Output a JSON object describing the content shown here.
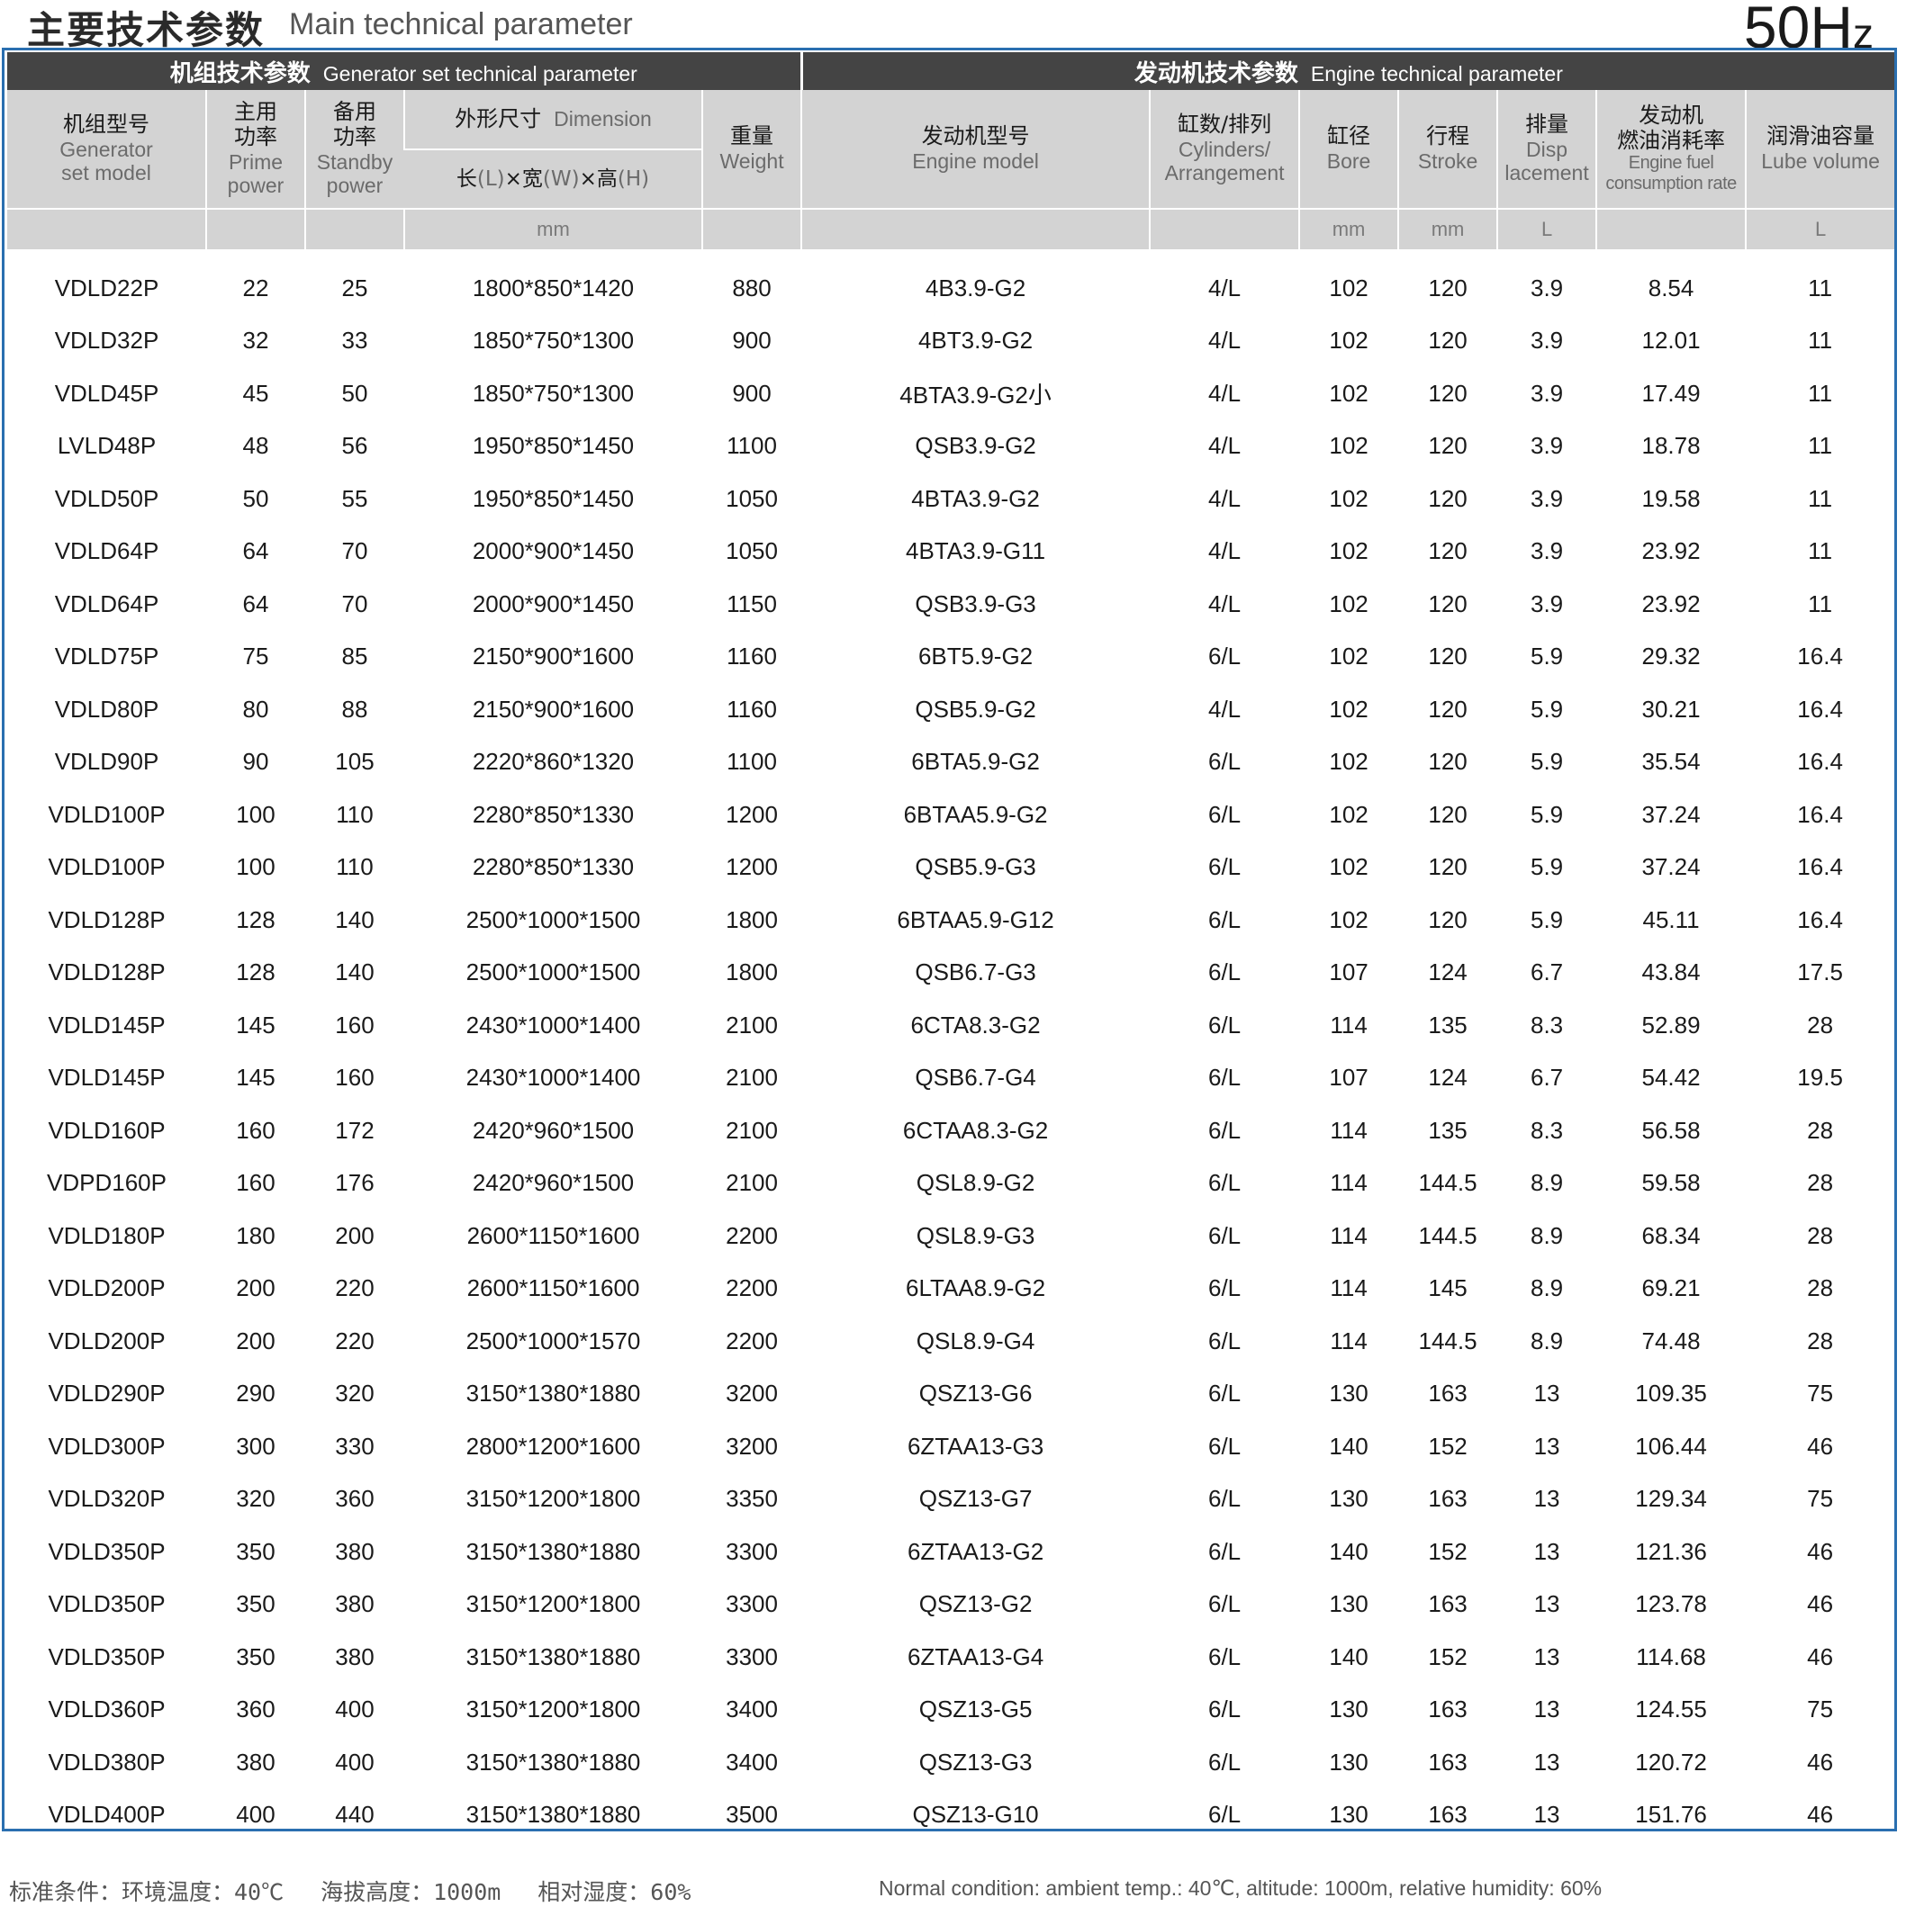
{
  "header": {
    "title_cn": "主要技术参数",
    "title_en": "Main technical parameter",
    "frequency_main": "50H",
    "frequency_suffix": "z"
  },
  "sections": {
    "generator_cn": "机组技术参数",
    "generator_en": "Generator set technical parameter",
    "engine_cn": "发动机技术参数",
    "engine_en": "Engine technical parameter"
  },
  "columns": {
    "model_cn": "机组型号",
    "model_en_1": "Generator",
    "model_en_2": "set model",
    "prime_cn_1": "主用",
    "prime_cn_2": "功率",
    "prime_en_1": "Prime",
    "prime_en_2": "power",
    "standby_cn_1": "备用",
    "standby_cn_2": "功率",
    "standby_en_1": "Standby",
    "standby_en_2": "power",
    "dimension_cn": "外形尺寸",
    "dimension_en": "Dimension",
    "dim_l_cn": "长",
    "dim_l": "(L)",
    "dim_w_cn": "×宽",
    "dim_w": "(W)",
    "dim_h_cn": "×高",
    "dim_h": "(H)",
    "weight_cn": "重量",
    "weight_en": "Weight",
    "engine_model_cn": "发动机型号",
    "engine_model_en": "Engine model",
    "cyl_cn": "缸数/排列",
    "cyl_en_1": "Cylinders/",
    "cyl_en_2": "Arrangement",
    "bore_cn": "缸径",
    "bore_en": "Bore",
    "stroke_cn": "行程",
    "stroke_en": "Stroke",
    "disp_cn": "排量",
    "disp_en_1": "Disp",
    "disp_en_2": "lacement",
    "fuel_cn_1": "发动机",
    "fuel_cn_2": "燃油消耗率",
    "fuel_en_1": "Engine fuel",
    "fuel_en_2": "consumption rate",
    "lube_cn": "润滑油容量",
    "lube_en": "Lube volume"
  },
  "units": {
    "dimension": "mm",
    "bore": "mm",
    "stroke": "mm",
    "displacement": "L",
    "lube": "L"
  },
  "rows": [
    [
      "VDLD22P",
      "22",
      "25",
      "1800*850*1420",
      "880",
      "4B3.9-G2",
      "4/L",
      "102",
      "120",
      "3.9",
      "8.54",
      "11"
    ],
    [
      "VDLD32P",
      "32",
      "33",
      "1850*750*1300",
      "900",
      "4BT3.9-G2",
      "4/L",
      "102",
      "120",
      "3.9",
      "12.01",
      "11"
    ],
    [
      "VDLD45P",
      "45",
      "50",
      "1850*750*1300",
      "900",
      "4BTA3.9-G2小",
      "4/L",
      "102",
      "120",
      "3.9",
      "17.49",
      "11"
    ],
    [
      "LVLD48P",
      "48",
      "56",
      "1950*850*1450",
      "1100",
      "QSB3.9-G2",
      "4/L",
      "102",
      "120",
      "3.9",
      "18.78",
      "11"
    ],
    [
      "VDLD50P",
      "50",
      "55",
      "1950*850*1450",
      "1050",
      "4BTA3.9-G2",
      "4/L",
      "102",
      "120",
      "3.9",
      "19.58",
      "11"
    ],
    [
      "VDLD64P",
      "64",
      "70",
      "2000*900*1450",
      "1050",
      "4BTA3.9-G11",
      "4/L",
      "102",
      "120",
      "3.9",
      "23.92",
      "11"
    ],
    [
      "VDLD64P",
      "64",
      "70",
      "2000*900*1450",
      "1150",
      "QSB3.9-G3",
      "4/L",
      "102",
      "120",
      "3.9",
      "23.92",
      "11"
    ],
    [
      "VDLD75P",
      "75",
      "85",
      "2150*900*1600",
      "1160",
      "6BT5.9-G2",
      "6/L",
      "102",
      "120",
      "5.9",
      "29.32",
      "16.4"
    ],
    [
      "VDLD80P",
      "80",
      "88",
      "2150*900*1600",
      "1160",
      "QSB5.9-G2",
      "4/L",
      "102",
      "120",
      "5.9",
      "30.21",
      "16.4"
    ],
    [
      "VDLD90P",
      "90",
      "105",
      "2220*860*1320",
      "1100",
      "6BTA5.9-G2",
      "6/L",
      "102",
      "120",
      "5.9",
      "35.54",
      "16.4"
    ],
    [
      "VDLD100P",
      "100",
      "110",
      "2280*850*1330",
      "1200",
      "6BTAA5.9-G2",
      "6/L",
      "102",
      "120",
      "5.9",
      "37.24",
      "16.4"
    ],
    [
      "VDLD100P",
      "100",
      "110",
      "2280*850*1330",
      "1200",
      "QSB5.9-G3",
      "6/L",
      "102",
      "120",
      "5.9",
      "37.24",
      "16.4"
    ],
    [
      "VDLD128P",
      "128",
      "140",
      "2500*1000*1500",
      "1800",
      "6BTAA5.9-G12",
      "6/L",
      "102",
      "120",
      "5.9",
      "45.11",
      "16.4"
    ],
    [
      "VDLD128P",
      "128",
      "140",
      "2500*1000*1500",
      "1800",
      "QSB6.7-G3",
      "6/L",
      "107",
      "124",
      "6.7",
      "43.84",
      "17.5"
    ],
    [
      "VDLD145P",
      "145",
      "160",
      "2430*1000*1400",
      "2100",
      "6CTA8.3-G2",
      "6/L",
      "114",
      "135",
      "8.3",
      "52.89",
      "28"
    ],
    [
      "VDLD145P",
      "145",
      "160",
      "2430*1000*1400",
      "2100",
      "QSB6.7-G4",
      "6/L",
      "107",
      "124",
      "6.7",
      "54.42",
      "19.5"
    ],
    [
      "VDLD160P",
      "160",
      "172",
      "2420*960*1500",
      "2100",
      "6CTAA8.3-G2",
      "6/L",
      "114",
      "135",
      "8.3",
      "56.58",
      "28"
    ],
    [
      "VDPD160P",
      "160",
      "176",
      "2420*960*1500",
      "2100",
      "QSL8.9-G2",
      "6/L",
      "114",
      "144.5",
      "8.9",
      "59.58",
      "28"
    ],
    [
      "VDLD180P",
      "180",
      "200",
      "2600*1150*1600",
      "2200",
      "QSL8.9-G3",
      "6/L",
      "114",
      "144.5",
      "8.9",
      "68.34",
      "28"
    ],
    [
      "VDLD200P",
      "200",
      "220",
      "2600*1150*1600",
      "2200",
      "6LTAA8.9-G2",
      "6/L",
      "114",
      "145",
      "8.9",
      "69.21",
      "28"
    ],
    [
      "VDLD200P",
      "200",
      "220",
      "2500*1000*1570",
      "2200",
      "QSL8.9-G4",
      "6/L",
      "114",
      "144.5",
      "8.9",
      "74.48",
      "28"
    ],
    [
      "VDLD290P",
      "290",
      "320",
      "3150*1380*1880",
      "3200",
      "QSZ13-G6",
      "6/L",
      "130",
      "163",
      "13",
      "109.35",
      "75"
    ],
    [
      "VDLD300P",
      "300",
      "330",
      "2800*1200*1600",
      "3200",
      "6ZTAA13-G3",
      "6/L",
      "140",
      "152",
      "13",
      "106.44",
      "46"
    ],
    [
      "VDLD320P",
      "320",
      "360",
      "3150*1200*1800",
      "3350",
      "QSZ13-G7",
      "6/L",
      "130",
      "163",
      "13",
      "129.34",
      "75"
    ],
    [
      "VDLD350P",
      "350",
      "380",
      "3150*1380*1880",
      "3300",
      "6ZTAA13-G2",
      "6/L",
      "140",
      "152",
      "13",
      "121.36",
      "46"
    ],
    [
      "VDLD350P",
      "350",
      "380",
      "3150*1200*1800",
      "3300",
      "QSZ13-G2",
      "6/L",
      "130",
      "163",
      "13",
      "123.78",
      "46"
    ],
    [
      "VDLD350P",
      "350",
      "380",
      "3150*1380*1880",
      "3300",
      "6ZTAA13-G4",
      "6/L",
      "140",
      "152",
      "13",
      "114.68",
      "46"
    ],
    [
      "VDLD360P",
      "360",
      "400",
      "3150*1200*1800",
      "3400",
      "QSZ13-G5",
      "6/L",
      "130",
      "163",
      "13",
      "124.55",
      "75"
    ],
    [
      "VDLD380P",
      "380",
      "400",
      "3150*1380*1880",
      "3400",
      "QSZ13-G3",
      "6/L",
      "130",
      "163",
      "13",
      "120.72",
      "46"
    ],
    [
      "VDLD400P",
      "400",
      "440",
      "3150*1380*1880",
      "3500",
      "QSZ13-G10",
      "6/L",
      "130",
      "163",
      "13",
      "151.76",
      "46"
    ]
  ],
  "footer": {
    "cond_cn": "标准条件：环境温度：40℃",
    "altitude_cn": "海拔高度：1000m",
    "humidity_cn": "相对湿度：60%",
    "cond_en": "Normal condition: ambient temp.: 40℃, altitude: 1000m, relative humidity: 60%"
  },
  "colors": {
    "band_bg": "#444444",
    "header_bg": "#d3d3d3",
    "frame_border": "#2a6fb0"
  }
}
